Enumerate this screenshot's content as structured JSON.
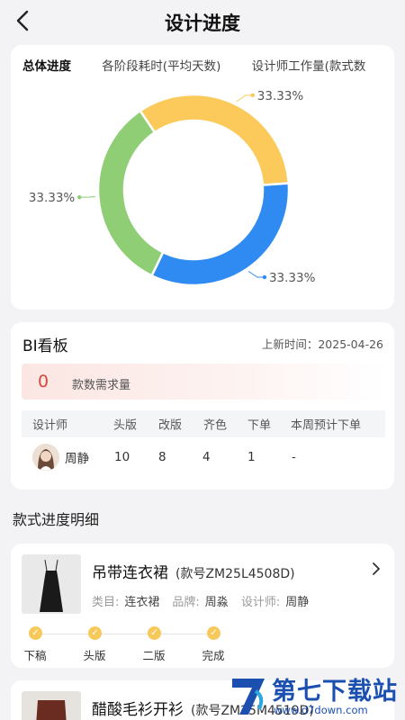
{
  "header": {
    "title": "设计进度",
    "back_icon": "chevron-left-icon"
  },
  "overview": {
    "tabs": [
      {
        "label": "总体进度",
        "active": true
      },
      {
        "label": "各阶段耗时(平均天数)",
        "active": false
      },
      {
        "label": "设计师工作量(款式数",
        "active": false
      }
    ]
  },
  "chart_data": {
    "type": "pie",
    "donut": true,
    "slices": [
      {
        "value": 33.33,
        "label": "33.33%",
        "color": "#fbca5b"
      },
      {
        "value": 33.33,
        "label": "33.33%",
        "color": "#2f8bf2"
      },
      {
        "value": 33.33,
        "label": "33.33%",
        "color": "#8fce75"
      }
    ]
  },
  "bi": {
    "title": "BI看板",
    "update_time": "上新时间：2025-04-26",
    "demand_count": "0",
    "demand_label": "款数需求量",
    "columns": [
      "设计师",
      "头版",
      "改版",
      "齐色",
      "下单",
      "本周预计下单"
    ],
    "rows": [
      {
        "designer": "周静",
        "first": "10",
        "revise": "8",
        "color": "4",
        "order": "1",
        "weekly": "-"
      }
    ]
  },
  "section_title": "款式进度明细",
  "items": [
    {
      "name": "吊带连衣裙",
      "code": "(款号ZM25L4508D)",
      "category_label": "类目:",
      "category": "连衣裙",
      "brand_label": "品牌:",
      "brand": "周淼",
      "designer_label": "设计师:",
      "designer": "周静",
      "steps": [
        "下稿",
        "头版",
        "二版",
        "完成"
      ]
    },
    {
      "name": "醋酸毛衫开衫",
      "code": "(款号ZM25M4519D)"
    }
  ],
  "watermark": {
    "text": "第七下载站",
    "url": "www.d7down.com"
  },
  "colors": {
    "accent_red": "#d9493a",
    "step_yellow": "#f7c95b",
    "brand_blue": "#1b4fb0"
  }
}
